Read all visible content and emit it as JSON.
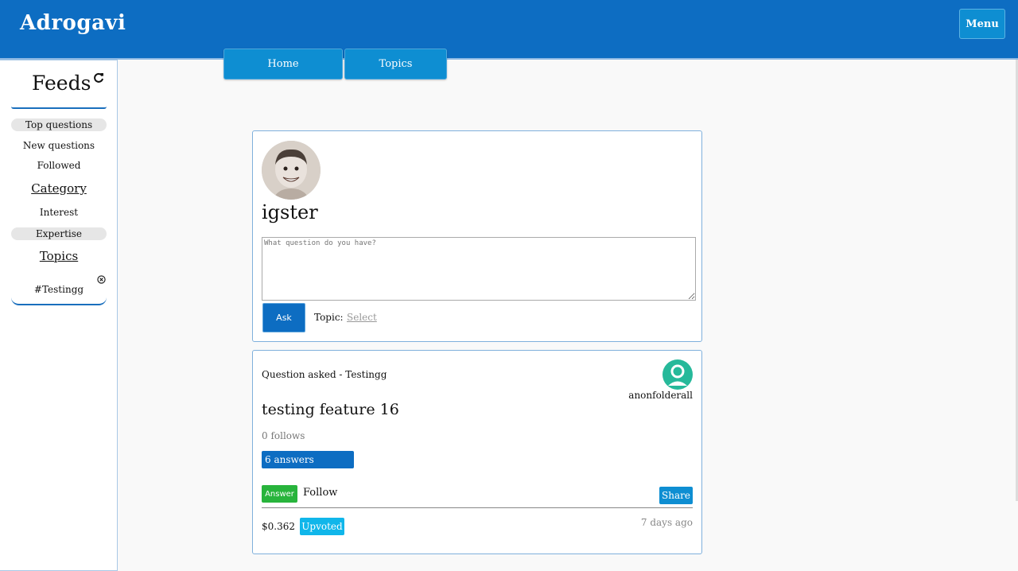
{
  "header": {
    "brand": "Adrogavi",
    "menu_label": "Menu",
    "color": "#0d6dc2"
  },
  "nav": {
    "tabs": [
      {
        "label": "Home"
      },
      {
        "label": "Topics"
      }
    ]
  },
  "sidebar": {
    "title": "Feeds",
    "feed_items": [
      {
        "label": "Top questions",
        "selected": true
      },
      {
        "label": "New questions",
        "selected": false
      },
      {
        "label": "Followed",
        "selected": false
      }
    ],
    "category_heading": "Category",
    "category_items": [
      {
        "label": "Interest",
        "selected": false
      },
      {
        "label": "Expertise",
        "selected": true
      }
    ],
    "topics_heading": "Topics",
    "topic_tags": [
      {
        "label": "#Testingg"
      }
    ]
  },
  "composer": {
    "username": "igster",
    "placeholder": "What question do you have?",
    "ask_label": "Ask",
    "topic_label": "Topic:",
    "topic_select_label": "Select"
  },
  "question": {
    "meta": "Question asked - Testingg",
    "author": "anonfolderall",
    "title": "testing feature 16",
    "follows": "0 follows",
    "answers": "6 answers",
    "answer_label": "Answer",
    "follow_label": "Follow",
    "share_label": "Share",
    "reward": "$0.362",
    "upvoted_label": "Upvoted",
    "time": "7 days ago"
  },
  "colors": {
    "primary": "#0d6dc2",
    "accent": "#0e8ed2",
    "answer_green": "#28b43c",
    "upvoted_cyan": "#10b6ea",
    "author_avatar_teal": "#26b99a"
  }
}
